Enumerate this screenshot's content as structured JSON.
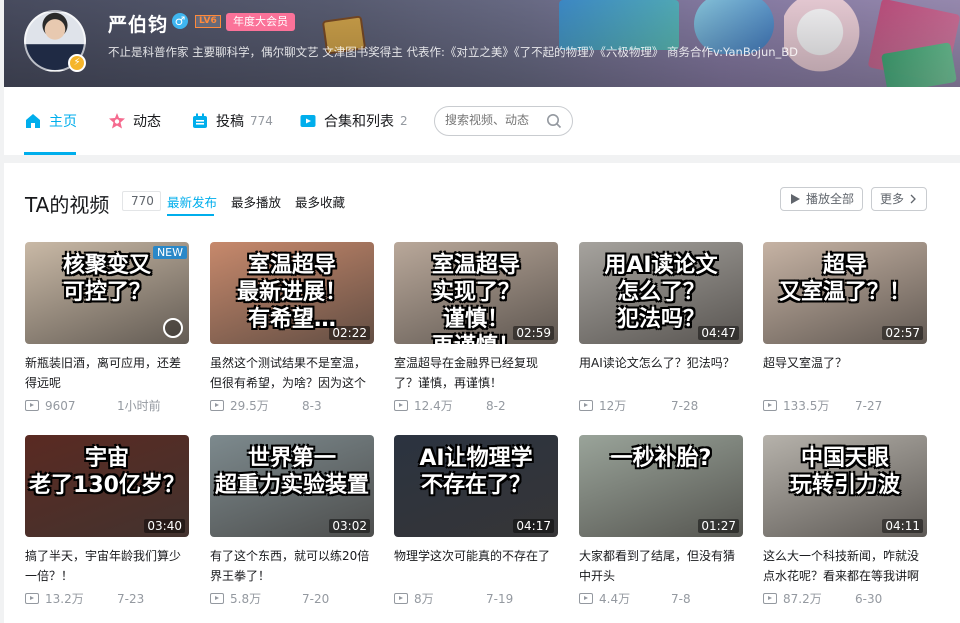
{
  "profile": {
    "name": "严伯钧",
    "gender_icon": "male-symbol",
    "level": "LV6",
    "vip_badge": "年度大会员",
    "signature": "不止是科普作家 主要聊科学，偶尔聊文艺 文津图书奖得主 代表作:《对立之美》《了不起的物理》《六极物理》 商务合作v:YanBojun_BD"
  },
  "nav": {
    "items": [
      {
        "label": "主页",
        "icon": "home-icon",
        "active": true
      },
      {
        "label": "动态",
        "icon": "dynamic-icon"
      },
      {
        "label": "投稿",
        "count": "774",
        "icon": "upload-icon"
      },
      {
        "label": "合集和列表",
        "count": "2",
        "icon": "collection-icon"
      }
    ],
    "search_placeholder": "搜索视频、动态"
  },
  "section": {
    "title": "TA的视频",
    "count": "770",
    "tabs": [
      "最新发布",
      "最多播放",
      "最多收藏"
    ],
    "play_all": "播放全部",
    "more": "更多"
  },
  "videos": [
    {
      "thumb_text": "核聚变又\n可控了？",
      "badge": "NEW",
      "duration": "",
      "title": "新瓶装旧酒，离可应用，还差得远呢",
      "views": "9607",
      "date": "1小时前",
      "bg": "#c9b9a6"
    },
    {
      "thumb_text": "室温超导\n最新进展！\n有希望…",
      "duration": "02:22",
      "title": "虽然这个测试结果不是室温，但很有希望，为啥？因为这个",
      "views": "29.5万",
      "date": "8-3",
      "bg": "#c7896c"
    },
    {
      "thumb_text": "室温超导\n实现了？\n谨慎！\n再谨慎！",
      "duration": "02:59",
      "title": "室温超导在金融界已经复现了？谨慎，再谨慎！",
      "views": "12.4万",
      "date": "8-2",
      "bg": "#b9a89a"
    },
    {
      "thumb_text": "用AI读论文\n怎么了？\n犯法吗？",
      "duration": "04:47",
      "title": "用AI读论文怎么了？犯法吗？",
      "views": "12万",
      "date": "7-28",
      "bg": "#a6a39e"
    },
    {
      "thumb_text": "超导\n又室温了？！",
      "duration": "02:57",
      "title": "超导又室温了？",
      "views": "133.5万",
      "date": "7-27",
      "bg": "#c6b3a4"
    },
    {
      "thumb_text": "宇宙\n老了130亿岁？",
      "duration": "03:40",
      "title": "搞了半天，宇宙年龄我们算少一倍？！",
      "views": "13.2万",
      "date": "7-23",
      "bg": "#5a2a22"
    },
    {
      "thumb_text": "世界第一\n超重力实验装置",
      "duration": "03:02",
      "title": "有了这个东西，就可以练20倍界王拳了！",
      "views": "5.8万",
      "date": "7-20",
      "bg": "#7d8a8e"
    },
    {
      "thumb_text": "AI让物理学\n不存在了？",
      "duration": "04:17",
      "title": "物理学这次可能真的不存在了",
      "views": "8万",
      "date": "7-19",
      "bg": "#2b3340"
    },
    {
      "thumb_text": "一秒补胎?",
      "duration": "01:27",
      "title": "大家都看到了结尾，但没有猜中开头",
      "views": "4.4万",
      "date": "7-8",
      "bg": "#9aa49a"
    },
    {
      "thumb_text": "中国天眼\n玩转引力波",
      "duration": "04:11",
      "title": "这么大一个科技新闻，咋就没点水花呢？看来都在等我讲啊",
      "views": "87.2万",
      "date": "6-30",
      "bg": "#b6b2ab"
    }
  ]
}
